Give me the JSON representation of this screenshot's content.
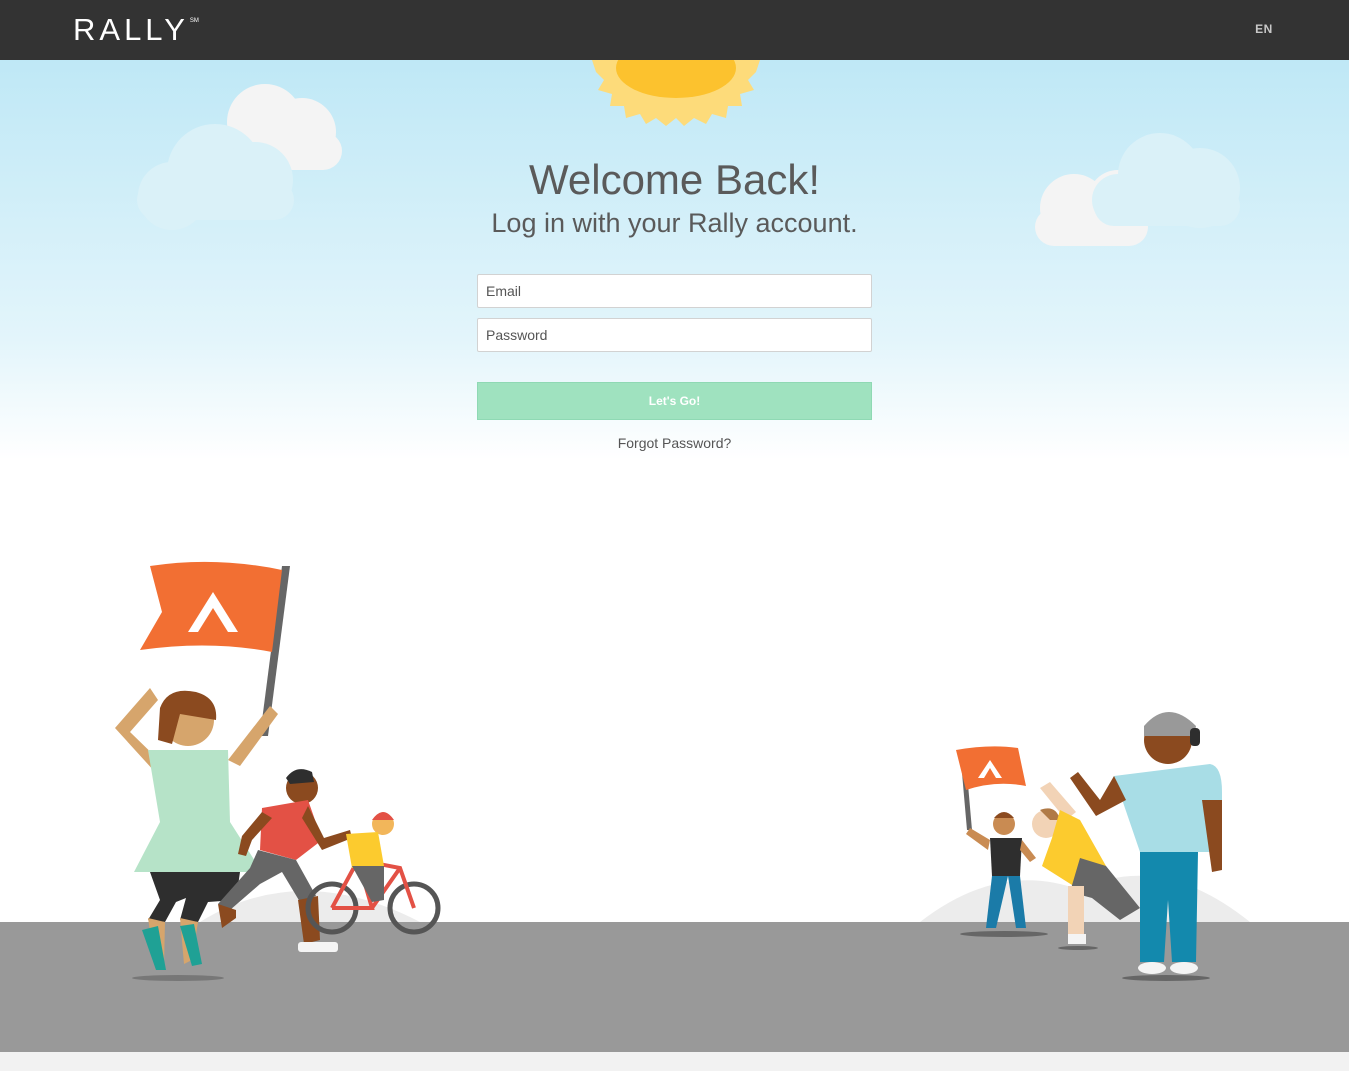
{
  "header": {
    "logo_text": "RALLY",
    "logo_mark": "SM",
    "language": "EN"
  },
  "login": {
    "title": "Welcome Back!",
    "subtitle": "Log in with your Rally account.",
    "email_placeholder": "Email",
    "password_placeholder": "Password",
    "submit_label": "Let's Go!",
    "forgot_label": "Forgot Password?"
  },
  "colors": {
    "topbar": "#333333",
    "sky": "#bfe8f6",
    "button": "#9fe2bf",
    "flag": "#f26f33",
    "ground": "#999999"
  },
  "illustration": {
    "icons": [
      "sun-icon",
      "cloud-icon",
      "flag-icon",
      "runner-icon",
      "cyclist-icon",
      "coach-icon"
    ]
  }
}
